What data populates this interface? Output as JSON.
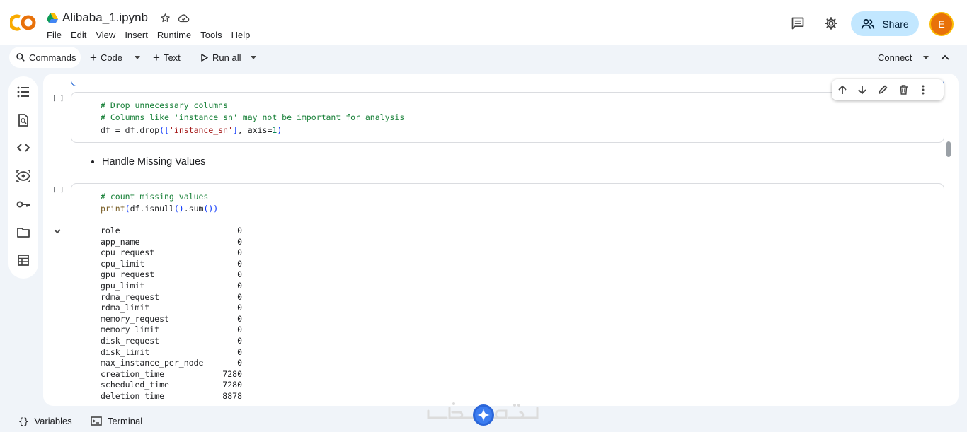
{
  "header": {
    "doc_title": "Alibaba_1.ipynb",
    "menu": [
      "File",
      "Edit",
      "View",
      "Insert",
      "Runtime",
      "Tools",
      "Help"
    ],
    "share_label": "Share",
    "avatar_letter": "E"
  },
  "toolbar": {
    "commands_label": "Commands",
    "code_label": "Code",
    "text_label": "Text",
    "run_all_label": "Run all",
    "connect_label": "Connect"
  },
  "cells": [
    {
      "bracket": "[ ]",
      "lines": [
        "# Drop unnecessary columns",
        "# Columns like 'instance_sn' may not be important for analysis",
        "df = df.drop(['instance_sn'], axis=1)"
      ]
    },
    {
      "bullet": "Handle Missing Values"
    },
    {
      "bracket": "[ ]",
      "lines": [
        "# count missing values",
        "print(df.isnull().sum())"
      ]
    }
  ],
  "output": [
    {
      "name": "role",
      "value": "0"
    },
    {
      "name": "app_name",
      "value": "0"
    },
    {
      "name": "cpu_request",
      "value": "0"
    },
    {
      "name": "cpu_limit",
      "value": "0"
    },
    {
      "name": "gpu_request",
      "value": "0"
    },
    {
      "name": "gpu_limit",
      "value": "0"
    },
    {
      "name": "rdma_request",
      "value": "0"
    },
    {
      "name": "rdma_limit",
      "value": "0"
    },
    {
      "name": "memory_request",
      "value": "0"
    },
    {
      "name": "memory_limit",
      "value": "0"
    },
    {
      "name": "disk_request",
      "value": "0"
    },
    {
      "name": "disk_limit",
      "value": "0"
    },
    {
      "name": "max_instance_per_node",
      "value": "0"
    },
    {
      "name": "creation_time",
      "value": "7280"
    },
    {
      "name": "scheduled_time",
      "value": "7280"
    },
    {
      "name": "deletion time",
      "value": "8878"
    }
  ],
  "statusbar": {
    "variables_label": "Variables",
    "terminal_label": "Terminal"
  },
  "colors": {
    "accent": "#0b57d0",
    "share_bg": "#c2e7ff",
    "chrome_bg": "#f0f4f9",
    "avatar_bg": "#e8710a",
    "comment": "#188038",
    "string": "#a31515",
    "number": "#098658"
  },
  "icons": [
    "colab-logo",
    "drive-icon",
    "star-icon",
    "cloud-icon",
    "comment-icon",
    "gear-icon",
    "people-icon",
    "search-icon",
    "plus-icon",
    "play-icon",
    "chevron-up-icon",
    "toc-icon",
    "find-icon",
    "code-icon",
    "eye-icon",
    "key-icon",
    "folder-icon",
    "table-icon",
    "arrow-up-icon",
    "arrow-down-icon",
    "pencil-icon",
    "trash-icon",
    "more-icon",
    "chevron-down-icon",
    "braces-icon",
    "terminal-icon"
  ]
}
